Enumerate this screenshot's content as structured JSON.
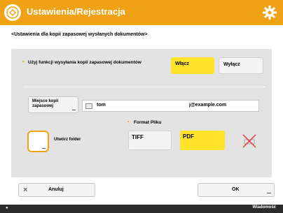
{
  "header": {
    "title": "Ustawienia/Rejestracja",
    "title_icon": "settings-register-icon",
    "gear_icon": "gear-icon",
    "accent": "#f0a216"
  },
  "subtitle": "<Ustawienia dla kopii zapasowej wysłanych dokumentów>",
  "backup": {
    "label": "Użyj funkcji wysyłania kopii zapasowej dokumentów",
    "on_label": "Włącz",
    "off_label": "Wyłącz",
    "selected": "on"
  },
  "destination": {
    "button_label": "Miejsce kopii zapasowej",
    "user": "tom",
    "address": "j@example.com"
  },
  "folder": {
    "label": "Utwórz folder",
    "checked": false
  },
  "format": {
    "label": "Format Pliku",
    "options": [
      "TIFF",
      "PDF"
    ],
    "selected": "PDF",
    "disabled_icon": "disabled-cross-icon"
  },
  "buttons": {
    "cancel": "Anuluj",
    "ok": "OK"
  },
  "statusbar": {
    "right": "Wiadomość"
  },
  "colors": {
    "selected": "#ffe32a",
    "panel": "#e3e3e3"
  }
}
